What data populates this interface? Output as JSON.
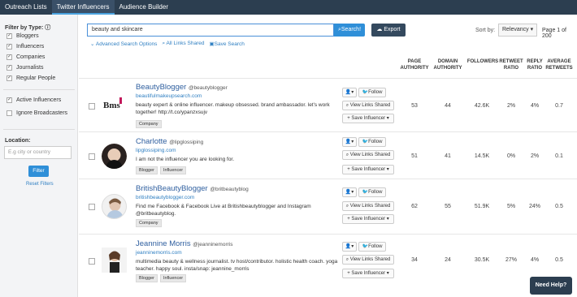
{
  "nav": {
    "tabs": [
      "Outreach Lists",
      "Twitter Influencers",
      "Audience Builder"
    ]
  },
  "sidebar": {
    "filter_title": "Filter by Type: ⓘ",
    "types": [
      {
        "label": "Bloggers",
        "checked": true
      },
      {
        "label": "Influencers",
        "checked": true
      },
      {
        "label": "Companies",
        "checked": true
      },
      {
        "label": "Journalists",
        "checked": true
      },
      {
        "label": "Regular People",
        "checked": true
      }
    ],
    "active_influencers": {
      "label": "Active Influencers",
      "checked": true
    },
    "ignore_broadcasters": {
      "label": "Ignore Broadcasters",
      "checked": false
    },
    "location_label": "Location:",
    "location_placeholder": "E.g city or country",
    "filter_button": "Filter",
    "reset_link": "Reset Filters"
  },
  "search": {
    "value": "beauty and skincare",
    "button": "Search!",
    "export": "Export",
    "advanced": "Advanced Search Options",
    "all_links": "All Links Shared",
    "save_search": "Save Search"
  },
  "sort": {
    "label": "Sort by:",
    "value": "Relevancy",
    "page_info": "Page 1 of 200"
  },
  "columns": [
    "PAGE AUTHORITY",
    "DOMAIN AUTHORITY",
    "FOLLOWERS",
    "RETWEET RATIO",
    "REPLY RATIO",
    "AVERAGE RETWEETS"
  ],
  "actions": {
    "follow": "Follow",
    "view_links": "View Links Shared",
    "save": "Save Influencer"
  },
  "rows": [
    {
      "name": "BeautyBlogger",
      "handle": "@beautyblogger",
      "site": "beautifulmakeupsearch.com",
      "bio": "beauty expert & online influencer. makeup obsessed. brand ambassador. let's work together! http://t.co/ypanzxsujv",
      "tags": [
        "Company"
      ],
      "page_authority": "53",
      "domain_authority": "44",
      "followers": "42.6K",
      "retweet_ratio": "2%",
      "reply_ratio": "4%",
      "avg_retweets": "0.7"
    },
    {
      "name": "Charlotte",
      "handle": "@lipglossiping",
      "site": "lipglossiping.com",
      "bio": "I am not the influencer you are looking for.",
      "tags": [
        "Blogger",
        "Influencer"
      ],
      "page_authority": "51",
      "domain_authority": "41",
      "followers": "14.5K",
      "retweet_ratio": "0%",
      "reply_ratio": "2%",
      "avg_retweets": "0.1"
    },
    {
      "name": "BritishBeautyBlogger",
      "handle": "@britbeautyblog",
      "site": "britishbeautyblogger.com",
      "bio": "Find me Facebook & Facebook Live at Britishbeautyblogger and Instagram @britbeautyblog.",
      "tags": [
        "Company"
      ],
      "page_authority": "62",
      "domain_authority": "55",
      "followers": "51.9K",
      "retweet_ratio": "5%",
      "reply_ratio": "24%",
      "avg_retweets": "0.5"
    },
    {
      "name": "Jeannine Morris",
      "handle": "@jeanninemorris",
      "site": "jeanninemorris.com",
      "bio": "multimedia beauty & wellness journalist. tv host/contributor. holistic health coach. yoga teacher. happy soul. insta/snap: jeannine_morris",
      "tags": [
        "Blogger",
        "Influencer"
      ],
      "page_authority": "34",
      "domain_authority": "24",
      "followers": "30.5K",
      "retweet_ratio": "27%",
      "reply_ratio": "4%",
      "avg_retweets": "0.5"
    }
  ],
  "help": "Need Help?"
}
